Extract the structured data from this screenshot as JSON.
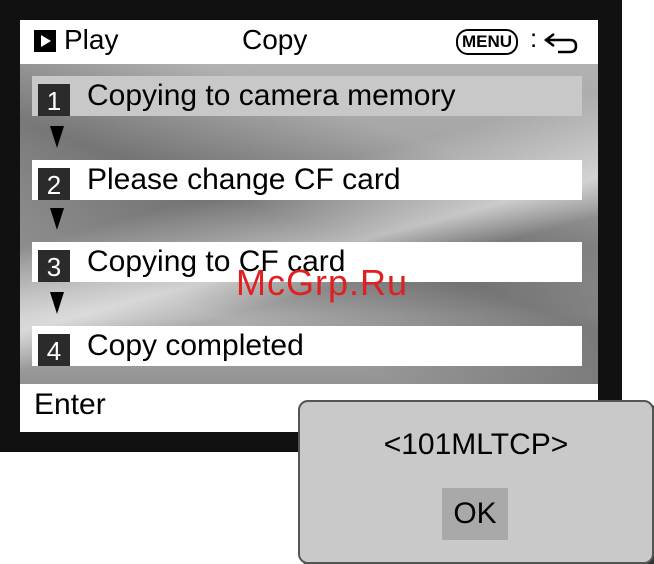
{
  "header": {
    "mode_label": "Play",
    "title": "Copy",
    "menu_label": "MENU",
    "menu_separator": ":"
  },
  "steps": [
    {
      "number": "1",
      "label": "Copying to camera memory",
      "active": true
    },
    {
      "number": "2",
      "label": "Please change CF card",
      "active": false
    },
    {
      "number": "3",
      "label": "Copying to CF card",
      "active": false
    },
    {
      "number": "4",
      "label": "Copy completed",
      "active": false
    }
  ],
  "footer": {
    "enter_label": "Enter"
  },
  "dialog": {
    "folder_name": "<101MLTCP>",
    "ok_label": "OK"
  },
  "watermark": "McGrp.Ru",
  "colors": {
    "frame": "#111111",
    "active_row": "#c8c8c8",
    "dialog_bg": "#c9c9c9",
    "watermark": "#e02020"
  },
  "icons": {
    "mode": "play-icon",
    "back": "back-arrow-icon"
  }
}
